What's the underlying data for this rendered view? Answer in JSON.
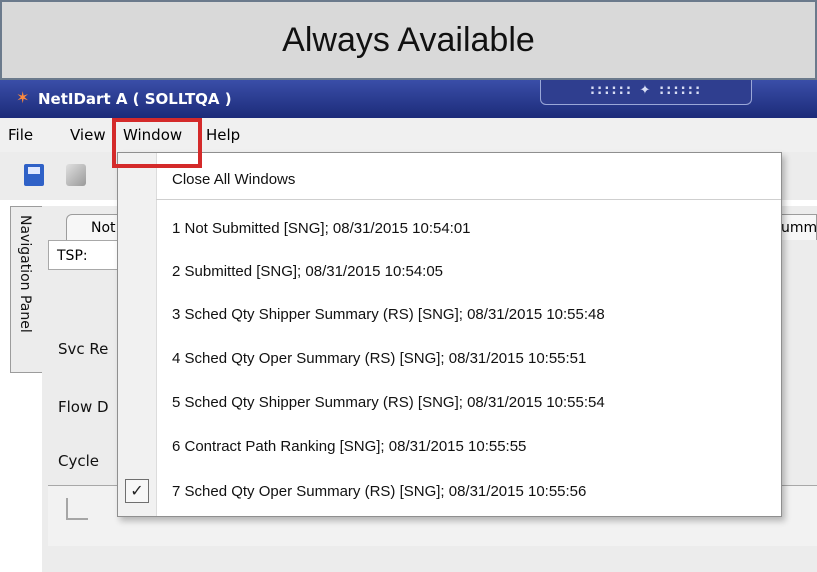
{
  "banner": {
    "text": "Always Available"
  },
  "window": {
    "title": "NetIDart A ( SOLLTQA )",
    "grip": "::::::  ✦  ::::::"
  },
  "menubar": {
    "items": [
      "File",
      "View",
      "Window",
      "Help"
    ]
  },
  "navpanel": {
    "label": "Navigation Panel"
  },
  "background": {
    "tab_label": "Not",
    "tab_right_label": "umm",
    "tsp_label": "TSP:",
    "fields": [
      "Svc Re",
      "Flow D",
      "Cycle"
    ]
  },
  "window_menu": {
    "close_all": "Close All Windows",
    "items": [
      "1 Not Submitted [SNG]; 08/31/2015 10:54:01",
      "2 Submitted [SNG]; 08/31/2015 10:54:05",
      "3 Sched Qty Shipper Summary (RS) [SNG]; 08/31/2015 10:55:48",
      "4 Sched Qty Oper Summary (RS) [SNG]; 08/31/2015 10:55:51",
      "5 Sched Qty Shipper Summary (RS) [SNG]; 08/31/2015 10:55:54",
      "6 Contract Path Ranking [SNG]; 08/31/2015 10:55:55",
      "7 Sched Qty Oper Summary (RS) [SNG]; 08/31/2015 10:55:56"
    ],
    "checked_glyph": "✓"
  },
  "colors": {
    "highlight": "#d42a2a",
    "titlebar": "#1c2b79"
  }
}
